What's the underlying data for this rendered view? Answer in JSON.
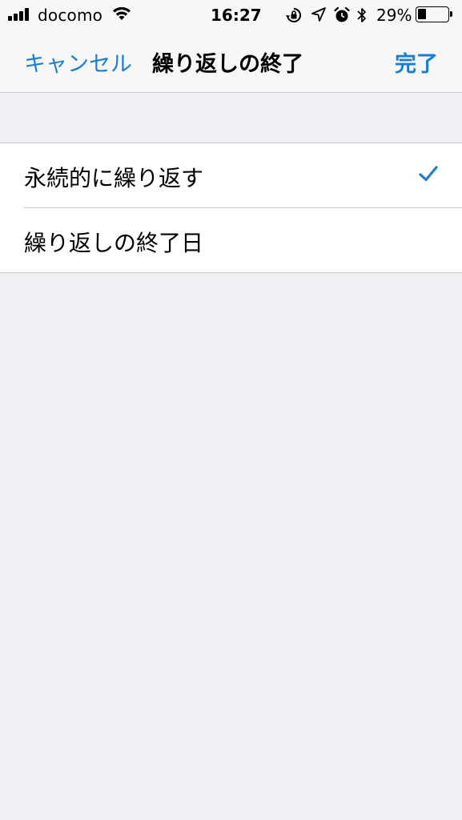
{
  "status_bar": {
    "carrier": "docomo",
    "time": "16:27",
    "battery_percent": "29%",
    "battery_level": 0.29,
    "icons": [
      "signal-icon",
      "wifi-icon",
      "orientation-lock-icon",
      "location-icon",
      "alarm-icon",
      "bluetooth-icon",
      "battery-icon"
    ]
  },
  "nav": {
    "cancel_label": "キャンセル",
    "title": "繰り返しの終了",
    "done_label": "完了"
  },
  "options": [
    {
      "label": "永続的に繰り返す",
      "selected": true
    },
    {
      "label": "繰り返しの終了日",
      "selected": false
    }
  ],
  "colors": {
    "accent": "#1a7fd4",
    "background": "#efeff4",
    "bar_background": "#f7f7f7",
    "separator": "#c8c7cc"
  }
}
